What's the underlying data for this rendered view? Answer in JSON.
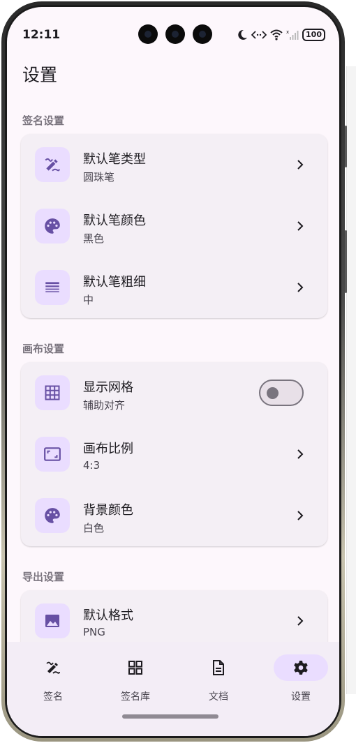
{
  "status": {
    "time": "12:11",
    "battery": "100"
  },
  "page": {
    "title": "设置"
  },
  "sections": [
    {
      "label": "签名设置",
      "items": [
        {
          "title": "默认笔类型",
          "subtitle": "圆珠笔",
          "icon": "pen-icon",
          "control": "chevron"
        },
        {
          "title": "默认笔颜色",
          "subtitle": "黑色",
          "icon": "palette-icon",
          "control": "chevron"
        },
        {
          "title": "默认笔粗细",
          "subtitle": "中",
          "icon": "line-weight-icon",
          "control": "chevron"
        }
      ]
    },
    {
      "label": "画布设置",
      "items": [
        {
          "title": "显示网格",
          "subtitle": "辅助对齐",
          "icon": "grid-icon",
          "control": "toggle",
          "checked": false
        },
        {
          "title": "画布比例",
          "subtitle": "4:3",
          "icon": "aspect-ratio-icon",
          "control": "chevron"
        },
        {
          "title": "背景颜色",
          "subtitle": "白色",
          "icon": "palette-icon",
          "control": "chevron"
        }
      ]
    },
    {
      "label": "导出设置",
      "items": [
        {
          "title": "默认格式",
          "subtitle": "PNG",
          "icon": "image-icon",
          "control": "chevron"
        }
      ]
    }
  ],
  "nav": [
    {
      "label": "签名",
      "icon": "signature-icon",
      "active": false
    },
    {
      "label": "签名库",
      "icon": "grid-view-icon",
      "active": false
    },
    {
      "label": "文档",
      "icon": "document-icon",
      "active": false
    },
    {
      "label": "设置",
      "icon": "gear-icon",
      "active": true
    }
  ],
  "colors": {
    "accent_container": "#eaddff",
    "icon": "#6750a4",
    "surface": "#fdf7fc",
    "card": "#f4eff5"
  }
}
